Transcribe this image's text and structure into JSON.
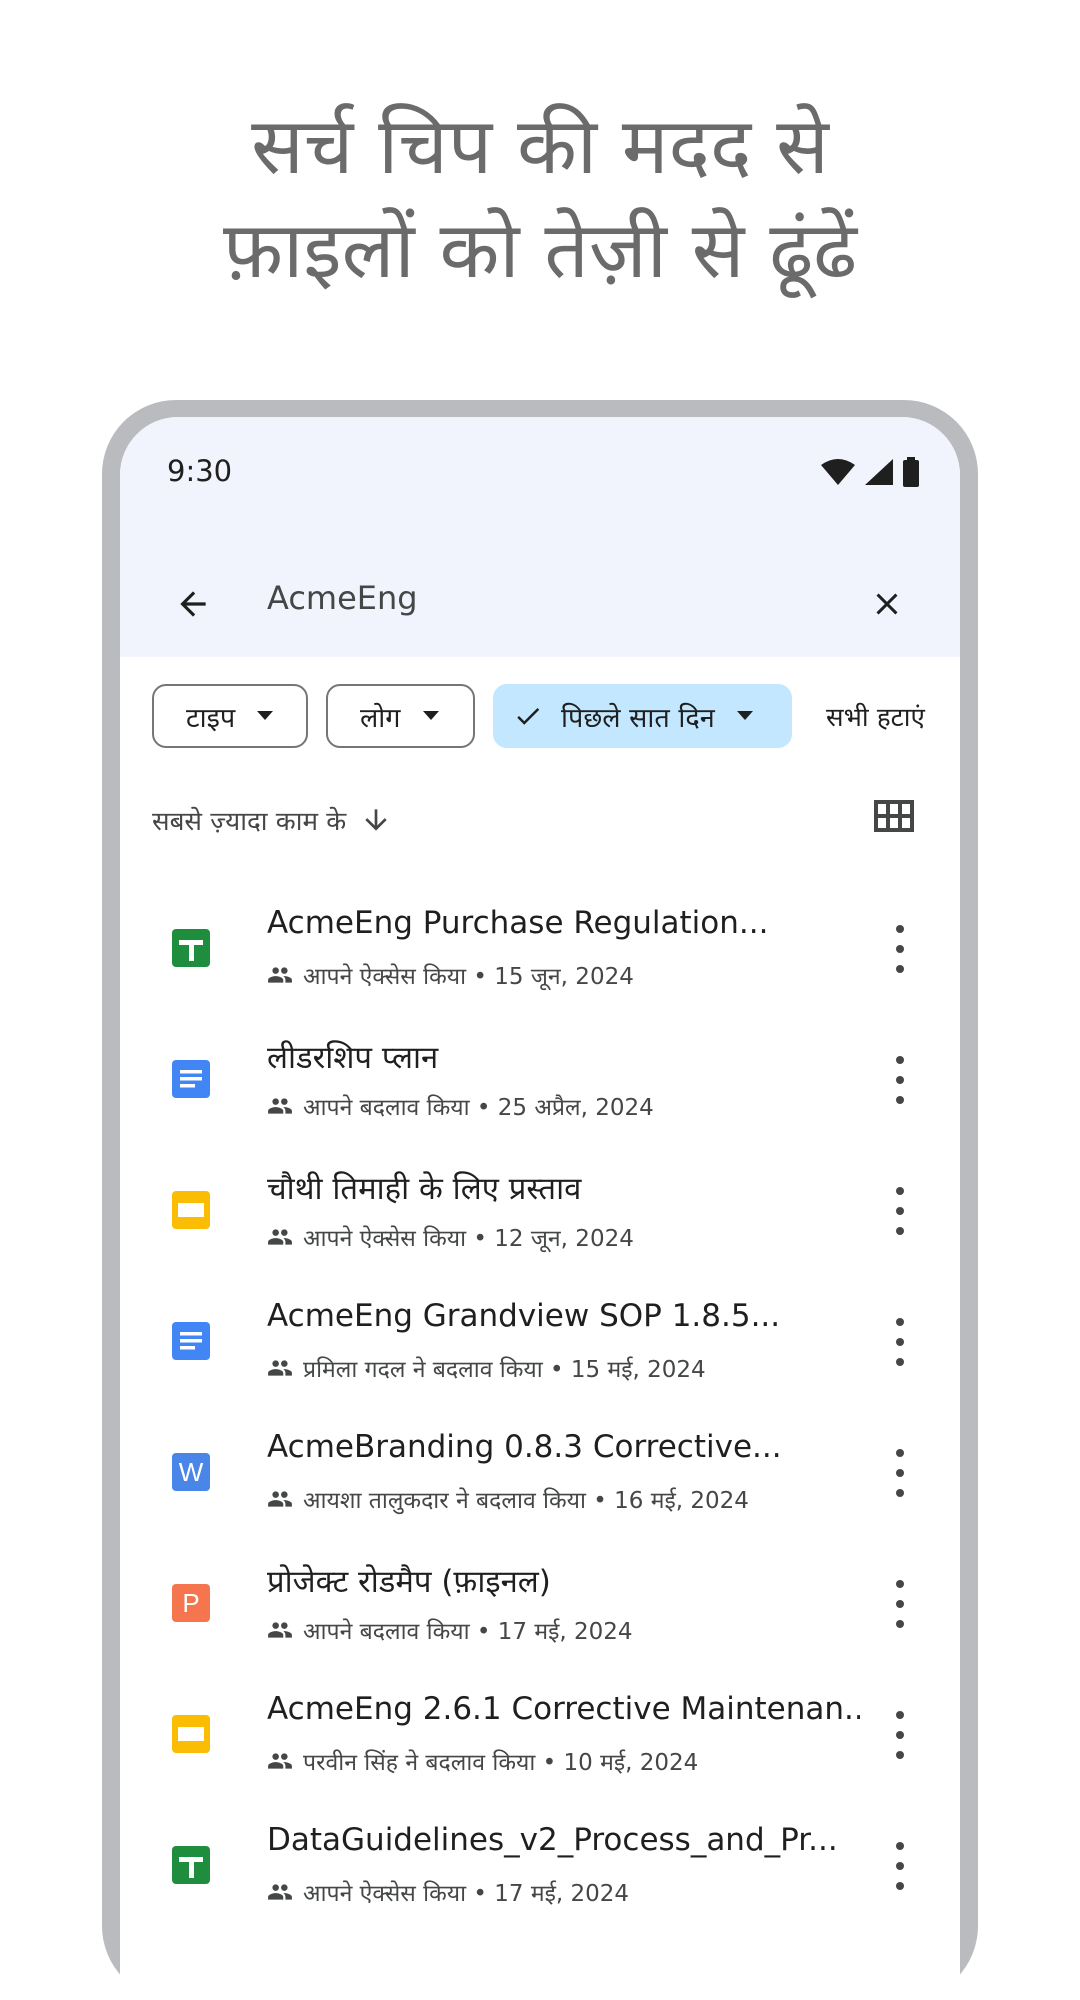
{
  "headline": {
    "line1": "सर्च चिप की मदद से",
    "line2": "फ़ाइलों को तेज़ी से ढूंढें"
  },
  "status_bar": {
    "time": "9:30"
  },
  "search": {
    "query": "AcmeEng"
  },
  "chips": {
    "type": "टाइप",
    "people": "लोग",
    "date": "पिछले सात दिन",
    "clear_all": "सभी हटाएं"
  },
  "sort": {
    "label": "सबसे ज़्यादा काम के"
  },
  "colors": {
    "sheets": "#1e8e3e",
    "docs": "#4285f4",
    "slides": "#fbbc04",
    "word": "#4a86e8",
    "powerpoint": "#f4754e",
    "chip_selected": "#c2e7ff",
    "topbar": "#f1f4fc"
  },
  "files": [
    {
      "title": "AcmeEng Purchase Regulation...",
      "subtitle": "आपने ऐक्सेस किया • 15 जून, 2024",
      "icon": "sheets-icon"
    },
    {
      "title": "लीडरशिप प्लान",
      "subtitle": "आपने बदलाव किया • 25 अप्रैल, 2024",
      "icon": "docs-icon"
    },
    {
      "title": "चौथी तिमाही के लिए प्रस्ताव",
      "subtitle": "आपने ऐक्सेस किया • 12 जून, 2024",
      "icon": "slides-icon"
    },
    {
      "title": "AcmeEng Grandview SOP 1.8.5...",
      "subtitle": "प्रमिला गदल ने बदलाव किया • 15 मई, 2024",
      "icon": "docs-icon"
    },
    {
      "title": "AcmeBranding 0.8.3 Corrective...",
      "subtitle": "आयशा तालुकदार ने बदलाव किया • 16 मई, 2024",
      "icon": "word-icon",
      "badge": "W"
    },
    {
      "title": "प्रोजेक्ट रोडमैप (फ़ाइनल)",
      "subtitle": "आपने बदलाव किया • 17 मई, 2024",
      "icon": "powerpoint-icon",
      "badge": "P"
    },
    {
      "title": "AcmeEng 2.6.1 Corrective Maintenan...",
      "subtitle": "परवीन सिंह ने बदलाव किया • 10 मई, 2024",
      "icon": "slides-icon"
    },
    {
      "title": "DataGuidelines_v2_Process_and_Pr...",
      "subtitle": "आपने ऐक्सेस किया • 17 मई, 2024",
      "icon": "sheets-icon"
    }
  ]
}
